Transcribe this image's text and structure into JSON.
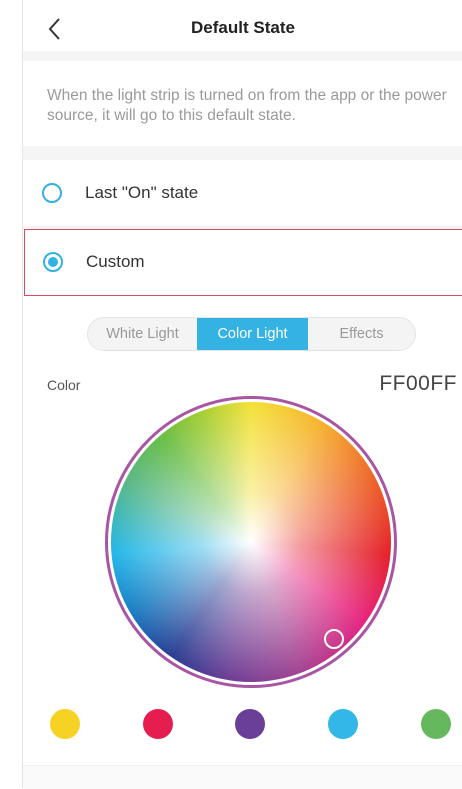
{
  "header": {
    "title": "Default State",
    "back_icon": "chevron-left"
  },
  "description": "When the light strip is turned on from the app or the power source, it will go to this default state.",
  "options": [
    {
      "label": "Last \"On\" state",
      "selected": false
    },
    {
      "label": "Custom",
      "selected": true
    }
  ],
  "tabs": [
    {
      "label": "White Light",
      "active": false
    },
    {
      "label": "Color Light",
      "active": true
    },
    {
      "label": "Effects",
      "active": false
    }
  ],
  "color": {
    "label": "Color",
    "hex": "FF00FF"
  },
  "presets": [
    {
      "color": "#f5d223"
    },
    {
      "color": "#e61e50"
    },
    {
      "color": "#6a3f98"
    },
    {
      "color": "#33b6e8"
    },
    {
      "color": "#66b85f"
    }
  ],
  "colors": {
    "accent": "#34b1e4",
    "selected_border": "#d94b65",
    "ring": "#a855a3"
  }
}
